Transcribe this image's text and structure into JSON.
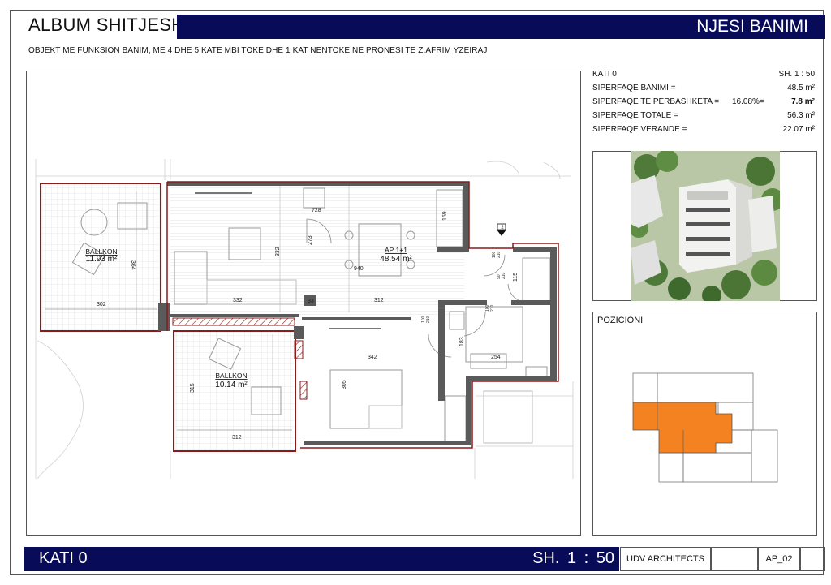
{
  "header": {
    "album_title": "ALBUM SHITJESH",
    "section_title": "NJESI BANIMI",
    "subtitle": "OBJEKT ME FUNKSION BANIM, ME 4 DHE 5 KATE MBI TOKE DHE 1 KAT NENTOKE NE PRONESI TE Z.AFRIM YZEIRAJ"
  },
  "info": {
    "floor": "KATI 0",
    "scale": "SH.  1 : 50",
    "rows": [
      {
        "label": "SIPERFAQE BANIMI =",
        "value": "48.5 m²"
      },
      {
        "label": "SIPERFAQE TE PERBASHKETA =",
        "pct": "16.08%=",
        "value": "7.8 m²"
      },
      {
        "label": "SIPERFAQE TOTALE =",
        "value": "56.3 m²"
      },
      {
        "label": "SIPERFAQE VERANDE =",
        "value": "22.07 m²"
      }
    ]
  },
  "plan": {
    "balcony1_name": "BALLKON",
    "balcony1_area": "11.93 m²",
    "balcony2_name": "BALLKON",
    "balcony2_area": "10.14 m²",
    "apartment_name": "AP 1+1",
    "apartment_area": "48.54 m²",
    "dims": {
      "d728": "728",
      "d159": "159",
      "d332a": "332",
      "d273": "273",
      "d940": "940",
      "d364": "364",
      "d302": "302",
      "d332b": "332",
      "d33": "33",
      "d312a": "312",
      "d115": "115",
      "d342": "342",
      "d305": "305",
      "d183": "183",
      "d254": "254",
      "d315": "315",
      "d312b": "312",
      "d100a": "100",
      "d210": "210",
      "d100b": "100",
      "d210b": "210",
      "d100c": "100",
      "d210c": "210",
      "d90": "90",
      "d2100": "210"
    },
    "entry_marker": "2",
    "colors": {
      "wall": "#5a5a5a",
      "boundary": "#8b1a1a",
      "hatch": "#8b1a1a"
    }
  },
  "position": {
    "label": "POZICIONI",
    "highlight_color": "#f58220"
  },
  "footer": {
    "floor": "KATI 0",
    "scale": "SH.  1 : 50",
    "firm": "UDV ARCHITECTS",
    "blank1": "",
    "code": "AP_02",
    "blank2": ""
  },
  "colors": {
    "brand_navy": "#080b58",
    "accent_orange": "#f58220"
  }
}
